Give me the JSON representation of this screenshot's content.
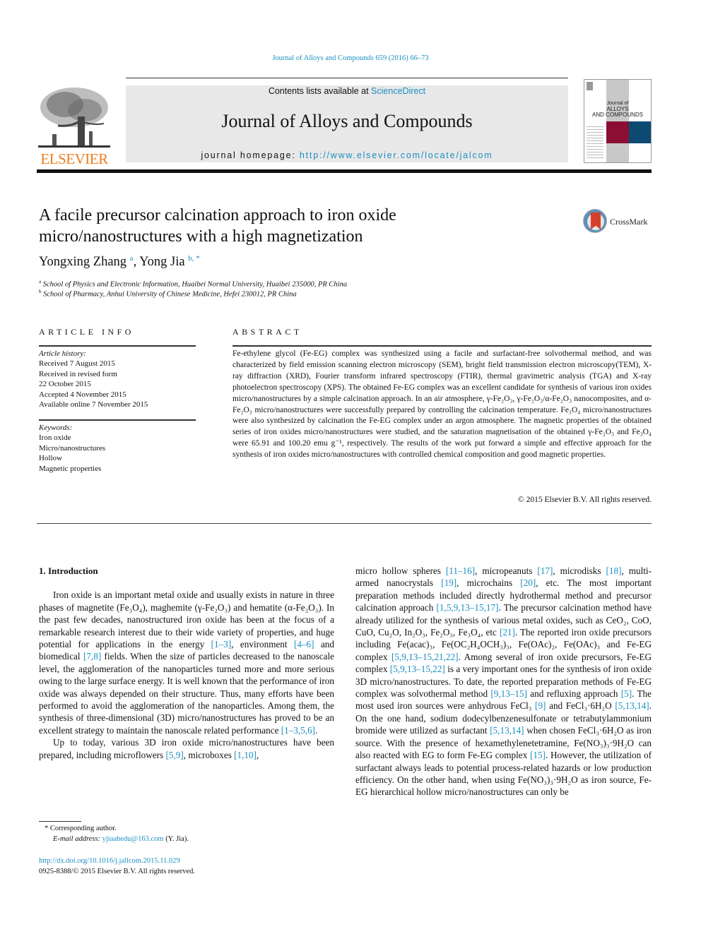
{
  "header": {
    "running_head": "Journal of Alloys and Compounds 659 (2016) 66–73",
    "contents_prefix": "Contents lists available at ",
    "contents_link": "ScienceDirect",
    "journal_title": "Journal of Alloys and Compounds",
    "homepage_prefix": "journal homepage: ",
    "homepage_url": "http://www.elsevier.com/locate/jalcom",
    "publisher_logo": "ELSEVIER",
    "cover_title_line1": "Journal of",
    "cover_title_line2": "ALLOYS",
    "cover_title_line3": "AND COMPOUNDS",
    "crossmark_label": "CrossMark"
  },
  "article": {
    "title": "A facile precursor calcination approach to iron oxide micro/nanostructures with a high magnetization",
    "authors": [
      {
        "name": "Yongxing Zhang",
        "sup": "a"
      },
      {
        "name": "Yong Jia",
        "sup": "b, *"
      }
    ],
    "affiliations": [
      {
        "sup": "a",
        "text": "School of Physics and Electronic Information, Huaibei Normal University, Huaibei 235000, PR China"
      },
      {
        "sup": "b",
        "text": "School of Pharmacy, Anhui University of Chinese Medicine, Hefei 230012, PR China"
      }
    ]
  },
  "article_info": {
    "heading": "ARTICLE INFO",
    "history_label": "Article history:",
    "history": [
      "Received 7 August 2015",
      "Received in revised form",
      "22 October 2015",
      "Accepted 4 November 2015",
      "Available online 7 November 2015"
    ],
    "keywords_label": "Keywords:",
    "keywords": [
      "Iron oxide",
      "Micro/nanostructures",
      "Hollow",
      "Magnetic properties"
    ]
  },
  "abstract": {
    "heading": "ABSTRACT",
    "text": "Fe-ethylene glycol (Fe-EG) complex was synthesized using a facile and surfactant-free solvothermal method, and was characterized by field emission scanning electron microscopy (SEM), bright field transmission electron microscopy(TEM), X-ray diffraction (XRD), Fourier transform infrared spectroscopy (FTIR), thermal gravimetric analysis (TGA) and X-ray photoelectron spectroscopy (XPS). The obtained Fe-EG complex was an excellent candidate for synthesis of various iron oxides micro/nanostructures by a simple calcination approach. In an air atmosphere, γ-Fe₂O₃, γ-Fe₂O₃/α-Fe₂O₃ nanocomposites, and α-Fe₂O₃ micro/nanostructures were successfully prepared by controlling the calcination temperature. Fe₃O₄ micro/nanostructures were also synthesized by calcination the Fe-EG complex under an argon atmosphere. The magnetic properties of the obtained series of iron oxides micro/nanostructures were studied, and the saturation magnetisation of the obtained γ-Fe₂O₃ and Fe₃O₄ were 65.91 and 100.20 emu g⁻¹, respectively. The results of the work put forward a simple and effective approach for the synthesis of iron oxides micro/nanostructures with controlled chemical composition and good magnetic properties.",
    "copyright": "© 2015 Elsevier B.V. All rights reserved."
  },
  "introduction": {
    "heading": "1.  Introduction",
    "paragraphs": [
      [
        {
          "t": "Iron oxide is an important metal oxide and usually exists in nature in three phases of magnetite (Fe₃O₄), maghemite (γ-Fe₂O₃) and hematite (α-Fe₂O₃). In the past few decades, nanostructured iron oxide has been at the focus of a remarkable research interest due to their wide variety of properties, and huge potential for applications in the energy "
        },
        {
          "ref": "[1–3]"
        },
        {
          "t": ", environment "
        },
        {
          "ref": "[4–6]"
        },
        {
          "t": " and biomedical "
        },
        {
          "ref": "[7,8]"
        },
        {
          "t": " fields. When the size of particles decreased to the nanoscale level, the agglomeration of the nanoparticles turned more and more serious owing to the large surface energy. It is well known that the performance of iron oxide was always depended on their structure. Thus, many efforts have been performed to avoid the agglomeration of the nanoparticles. Among them, the synthesis of three-dimensional (3D) micro/nanostructures has proved to be an excellent strategy to maintain the nanoscale related performance "
        },
        {
          "ref": "[1–3,5,6]"
        },
        {
          "t": "."
        }
      ],
      [
        {
          "t": "Up to today, various 3D iron oxide micro/nanostructures have been prepared, including microflowers "
        },
        {
          "ref": "[5,9]"
        },
        {
          "t": ", microboxes "
        },
        {
          "ref": "[1,10]"
        },
        {
          "t": ","
        }
      ]
    ],
    "right_column": [
      {
        "t": "micro hollow spheres "
      },
      {
        "ref": "[11–16]"
      },
      {
        "t": ", micropeanuts "
      },
      {
        "ref": "[17]"
      },
      {
        "t": ", microdisks "
      },
      {
        "ref": "[18]"
      },
      {
        "t": ", multi-armed nanocrystals "
      },
      {
        "ref": "[19]"
      },
      {
        "t": ", microchains "
      },
      {
        "ref": "[20]"
      },
      {
        "t": ", etc. The most important preparation methods included directly hydrothermal method and precursor calcination approach "
      },
      {
        "ref": "[1,5,9,13–15,17]"
      },
      {
        "t": ". The precursor calcination method have already utilized for the synthesis of various metal oxides, such as CeO₂, CoO, CuO, Cu₂O, In₂O₃, Fe₂O₃, Fe₃O₄, etc "
      },
      {
        "ref": "[21]"
      },
      {
        "t": ". The reported iron oxide precursors including Fe(acac)₃, Fe(OC₂H₄OCH₃)₃, Fe(OAc)₂, Fe(OAc)₃ and Fe-EG complex "
      },
      {
        "ref": "[5,9,13–15,21,22]"
      },
      {
        "t": ". Among several of iron oxide precursors, Fe-EG complex "
      },
      {
        "ref": "[5,9,13–15,22]"
      },
      {
        "t": " is a very important ones for the synthesis of iron oxide 3D micro/nanostructures. To date, the reported preparation methods of Fe-EG complex was solvothermal method "
      },
      {
        "ref": "[9,13–15]"
      },
      {
        "t": " and refluxing approach "
      },
      {
        "ref": "[5]"
      },
      {
        "t": ". The most used iron sources were anhydrous FeCl₃ "
      },
      {
        "ref": "[9]"
      },
      {
        "t": " and FeCl₃·6H₂O "
      },
      {
        "ref": "[5,13,14]"
      },
      {
        "t": ". On the one hand, sodium dodecylbenzenesulfonate or tetrabutylammonium bromide were utilized as surfactant "
      },
      {
        "ref": "[5,13,14]"
      },
      {
        "t": " when chosen FeCl₃·6H₂O as iron source. With the presence of hexamethylenetetramine, Fe(NO₃)₃·9H₂O can also reacted with EG to form Fe-EG complex "
      },
      {
        "ref": "[15]"
      },
      {
        "t": ". However, the utilization of surfactant always leads to potential process-related hazards or low production efficiency. On the other hand, when using Fe(NO₃)₃·9H₂O as iron source, Fe-EG hierarchical hollow micro/nanostructures can only be"
      }
    ]
  },
  "footnote": {
    "corresponding": "* Corresponding author.",
    "email_label": "E-mail address: ",
    "email": "yjiaahedu@163.com",
    "email_suffix": " (Y. Jia)."
  },
  "doi": {
    "url": "http://dx.doi.org/10.1016/j.jallcom.2015.11.029",
    "issn_line": "0925-8388/© 2015 Elsevier B.V. All rights reserved."
  }
}
